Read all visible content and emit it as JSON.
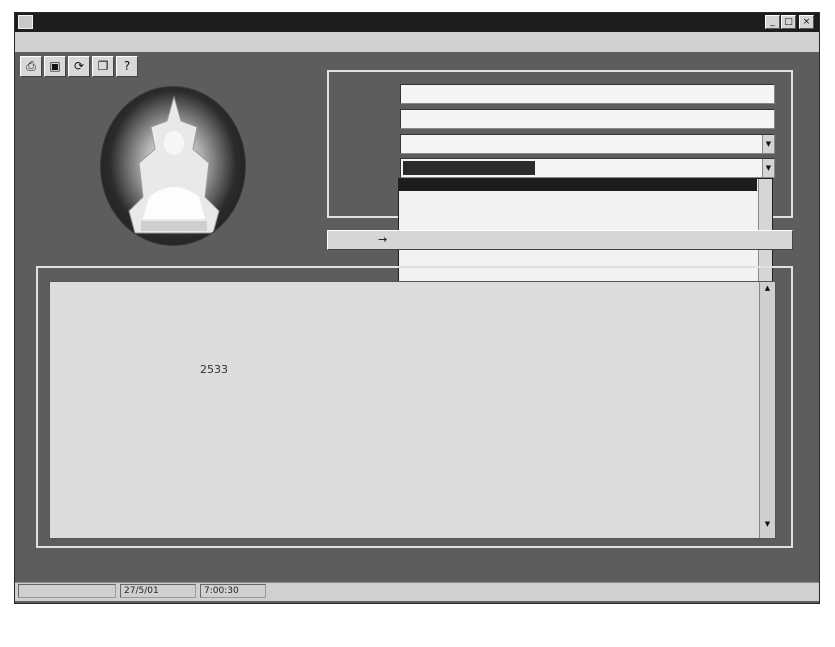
{
  "window": {
    "title": "",
    "minimize": "_",
    "maximize": "□",
    "close": "×"
  },
  "menu": [
    {
      "label": ""
    },
    {
      "label": ""
    },
    {
      "label": ""
    },
    {
      "label": ""
    }
  ],
  "toolbar": {
    "print": "⎙",
    "save": "▣",
    "refresh": "⟳",
    "copy": "❐",
    "help": "?"
  },
  "search": {
    "group_label": "",
    "fields": [
      {
        "label": "",
        "value": ""
      },
      {
        "label": "",
        "value": ""
      },
      {
        "label": "",
        "value": ""
      },
      {
        "label": "",
        "value": ""
      },
      {
        "label": "",
        "value": ""
      }
    ],
    "dropdown_items": [
      "",
      "",
      "",
      "",
      "",
      "",
      "",
      ""
    ],
    "button_label": "→"
  },
  "detail": {
    "group_label": "",
    "rows": [
      {
        "label": "",
        "value": ""
      },
      {
        "label": "",
        "value": ""
      },
      {
        "label": "",
        "value": ""
      },
      {
        "label": "",
        "value": ""
      },
      {
        "label": "",
        "value": "2533"
      },
      {
        "label": "",
        "value": ""
      }
    ],
    "abstract_label": "",
    "abstract_lines": [
      "",
      "",
      ""
    ]
  },
  "status": {
    "left": "",
    "date": "27/5/01",
    "time": "7:00:30"
  },
  "colors": {
    "window_bg": "#5d5d5d",
    "titlebar": "#1c1c1c",
    "panel": "#dcdcdc"
  }
}
